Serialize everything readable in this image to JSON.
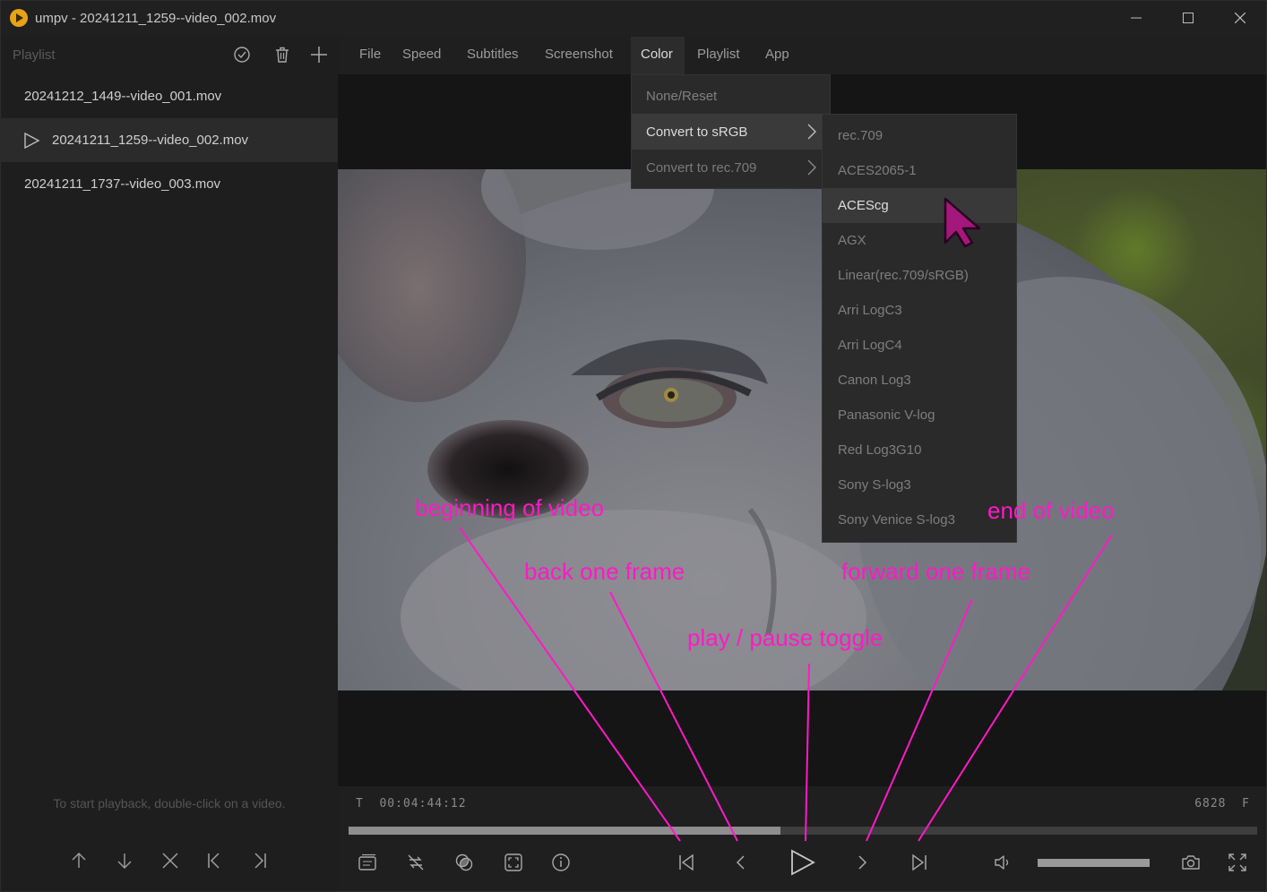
{
  "window": {
    "title": "umpv - 20241211_1259--video_002.mov"
  },
  "sidebar": {
    "title": "Playlist",
    "items": [
      {
        "label": "20241212_1449--video_001.mov",
        "active": false
      },
      {
        "label": "20241211_1259--video_002.mov",
        "active": true
      },
      {
        "label": "20241211_1737--video_003.mov",
        "active": false
      }
    ],
    "hint": "To start playback, double-click on a video."
  },
  "menu": {
    "items": [
      "File",
      "Speed",
      "Subtitles",
      "Screenshot",
      "Color",
      "Playlist",
      "App"
    ],
    "open": "Color"
  },
  "color_menu": {
    "items": [
      {
        "label": "None/Reset",
        "submenu": false
      },
      {
        "label": "Convert to sRGB",
        "submenu": true,
        "highlighted": true
      },
      {
        "label": "Convert to rec.709",
        "submenu": true
      }
    ]
  },
  "srgb_submenu": {
    "items": [
      "rec.709",
      "ACES2065-1",
      "ACEScg",
      "AGX",
      "Linear(rec.709/sRGB)",
      "Arri LogC3",
      "Arri LogC4",
      "Canon Log3",
      "Panasonic V-log",
      "Red Log3G10",
      "Sony S-log3",
      "Sony Venice S-log3"
    ],
    "highlighted": "ACEScg"
  },
  "controls": {
    "timecode_prefix": "T",
    "timecode": "00:04:44:12",
    "frame_count": "6828",
    "frame_suffix": "F",
    "progress": 0.475,
    "volume": 1.0
  },
  "annotations": {
    "beginning": "beginning of video",
    "back": "back one frame",
    "play": "play / pause toggle",
    "forward": "forward one frame",
    "end": "end of video"
  },
  "colors": {
    "annotation": "#ff19c8",
    "accent": "#e8a317"
  }
}
